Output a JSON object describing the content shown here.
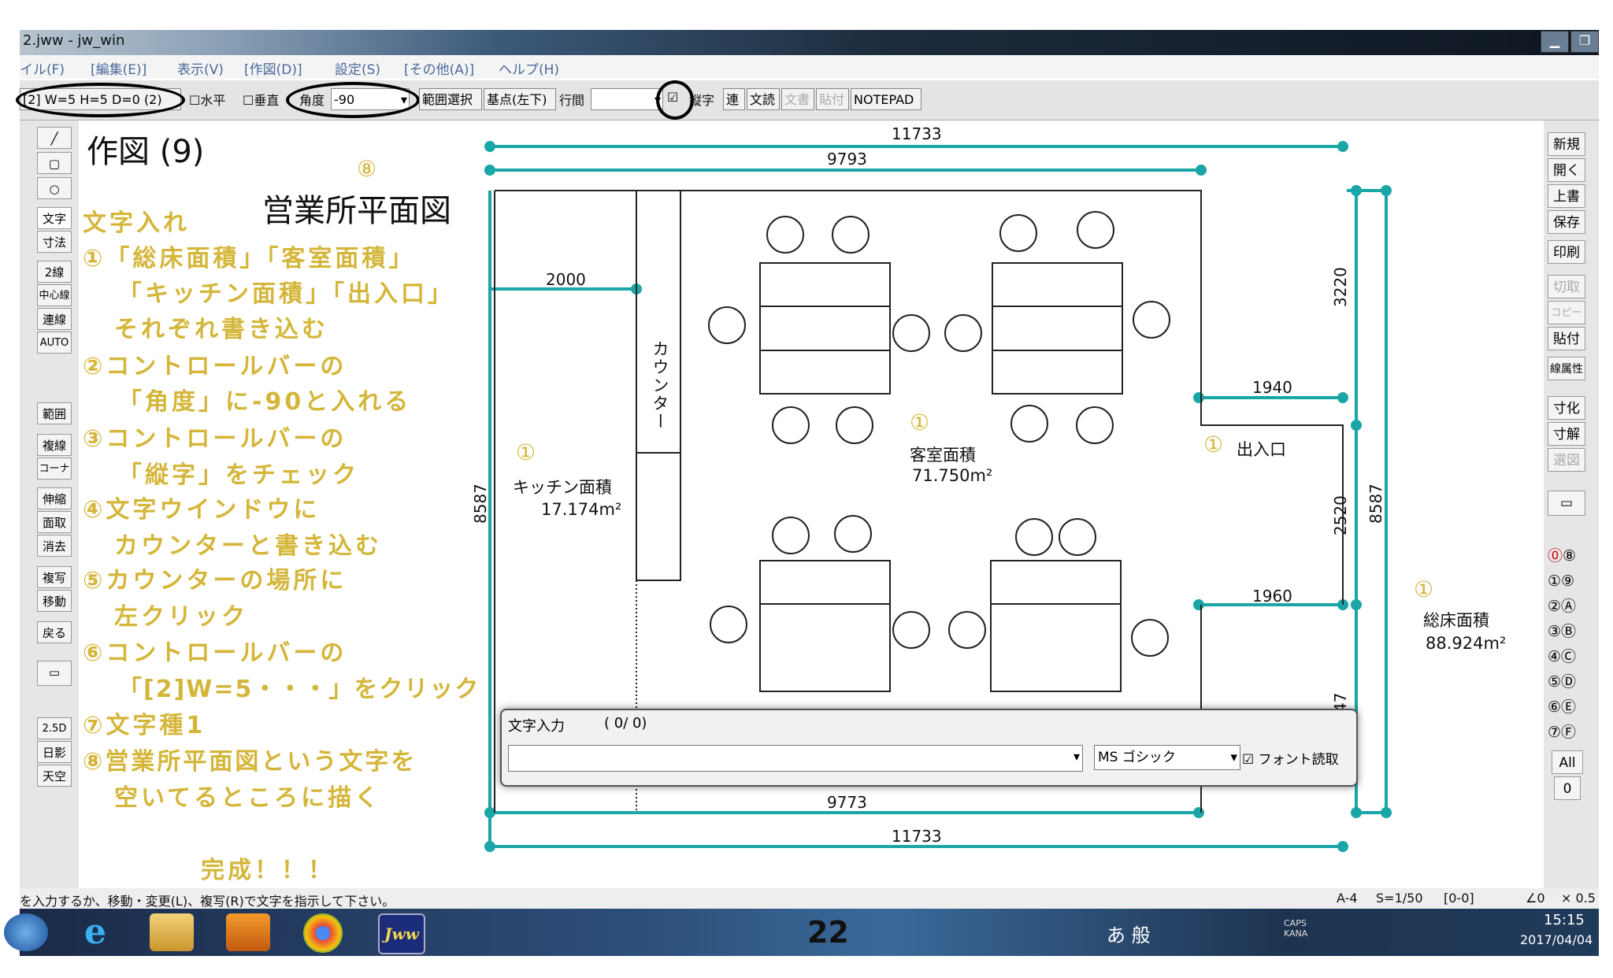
{
  "window": {
    "title": "2.jww - jw_win"
  },
  "menu": [
    "イル(F)",
    "[編集(E)]",
    "表示(V)",
    "[作図(D)]",
    "設定(S)",
    "[その他(A)]",
    "ヘルプ(H)"
  ],
  "toolbar": {
    "font_spec": "[2] W=5 H=5 D=0 (2)",
    "horizontal": "水平",
    "vertical": "垂直",
    "angle_label": "角度",
    "angle_value": "-90",
    "range_select": "範囲選択",
    "base_point": "基点(左下)",
    "line_spacing": "行間",
    "vertical_text": "縦字",
    "continuous": "連",
    "read_text": "文読",
    "write_text": "文書",
    "paste": "貼付",
    "notepad": "NOTEPAD"
  },
  "left_tools": [
    "文字",
    "寸法",
    "2線",
    "中心線",
    "連線",
    "AUTO",
    "範囲",
    "複線",
    "コーナー",
    "伸縮",
    "面取",
    "消去",
    "複写",
    "移動",
    "戻る",
    "2.5D",
    "日影",
    "天空"
  ],
  "right_tools": [
    "新規",
    "開く",
    "上書",
    "保存",
    "印刷",
    "切取",
    "コピー",
    "貼付",
    "線属性",
    "寸化",
    "寸解",
    "選図",
    "All",
    "0"
  ],
  "right_layers": [
    "⓪",
    "⑧",
    "①",
    "⑨",
    "②",
    "Ⓐ",
    "③",
    "Ⓑ",
    "④",
    "Ⓒ",
    "⑤",
    "Ⓓ",
    "⑥",
    "Ⓔ",
    "⑦",
    "Ⓕ"
  ],
  "instructions": {
    "heading": "作図 (9)",
    "lines": [
      "文字入れ",
      "①「総床面積」「客室面積」",
      "「キッチン面積」「出入口」",
      "それぞれ書き込む",
      "②コントロールバーの",
      "「角度」に-90と入れる",
      "③コントロールバーの",
      "「縦字」をチェック",
      "④文字ウインドウに",
      "カウンターと書き込む",
      "⑤カウンターの場所に",
      "左クリック",
      "⑥コントロールバーの",
      "「[2]W=5・・・」をクリック",
      "⑦文字種1",
      "⑧営業所平面図という文字を",
      "空いてるところに描く"
    ],
    "complete": "完成！！！"
  },
  "drawing": {
    "title": "営業所平面図",
    "title_marker": "⑧",
    "dims": {
      "top_total": "11733",
      "top_inner": "9793",
      "bottom_inner": "9773",
      "bottom_total": "11733",
      "kitchen_width": "2000",
      "right_upper": "3220",
      "right_mid": "2520",
      "right_lower": "47",
      "right_total": "8587",
      "left_total": "8587",
      "entrance_top": "1940",
      "entrance_bottom": "1960"
    },
    "counter_label": "カウンター",
    "kitchen": {
      "marker": "①",
      "name": "キッチン面積",
      "area": "17.174m²"
    },
    "guest": {
      "marker": "①",
      "name": "客室面積",
      "area": "71.750m²"
    },
    "entrance": {
      "marker": "①",
      "name": "出入口"
    },
    "total": {
      "marker": "①",
      "name": "総床面積",
      "area": "88.924m²"
    }
  },
  "text_dialog": {
    "title": "文字入力",
    "count": "( 0/  0)",
    "input_value": "",
    "font": "MS ゴシック",
    "font_read": "フォント読取"
  },
  "status": {
    "message": "を入力するか、移動・変更(L)、複写(R)で文字を指示して下さい。",
    "paper": "A-4",
    "scale": "S=1/50",
    "layer": "[0-0]",
    "angle": "∠0",
    "zoom": "× 0.5"
  },
  "taskbar": {
    "page_number": "22",
    "time": "15:15",
    "date": "2017/04/04",
    "ime": "あ 般",
    "caps": "CAPS KANA"
  },
  "colors": {
    "dimension": "#1aa6a6",
    "instruction": "#d4b63a",
    "annotation_ring": "#000000"
  }
}
